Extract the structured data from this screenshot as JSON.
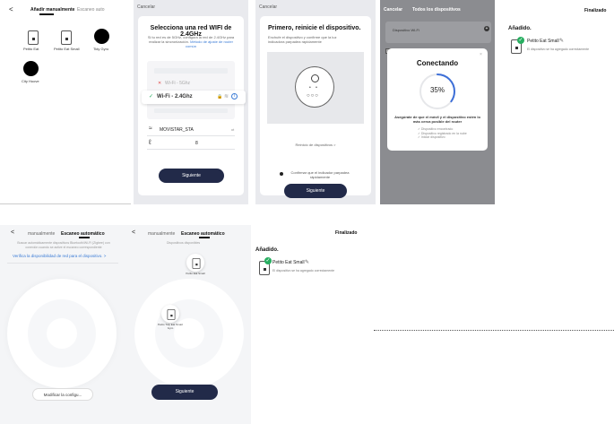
{
  "p1": {
    "back": "<",
    "tab_manual": "Añadir manualmente",
    "tab_auto": "Escaneo auto",
    "devices": [
      {
        "name": "Petito Eat",
        "icon": "feeder-icon"
      },
      {
        "name": "Petito Eat Small",
        "icon": "feeder-icon"
      },
      {
        "name": "Tidy Gyro",
        "icon": "black-circle-icon"
      },
      {
        "name": "City Hoove",
        "icon": "black-circle-icon"
      }
    ]
  },
  "p2": {
    "cancel": "Cancelar",
    "title": "Selecciona una red WIFI de 2.4GHz",
    "subtitle": "Si tu red es de 5GHz, configura la red de 2.4GHz para realizar la sincronización.",
    "link": "Método de ajuste de router común",
    "wifi_5g": "Wi-Fi - 5Ghz",
    "wifi_24g": "Wi-Fi - 2.4Ghz",
    "network": "MOVISTAR_STA",
    "password_mask": "8",
    "next": "Siguiente"
  },
  "p3": {
    "cancel": "Cancelar",
    "title": "Primero, reinicie el dispositivo.",
    "subtitle": "Enchufe el dispositivo y confirme que la luz indicadora parpadea rápidamente",
    "reset_link": "Reinicio de dispositivos >",
    "confirm": "Confirmar que el indicador parpadea rápidamente",
    "next": "Siguiente"
  },
  "p4": {
    "cancel": "Cancelar",
    "all_devices": "Todos los dispositivos",
    "wifi_label": "Dispositivo Wi-Fi",
    "modal_title": "Conectando",
    "percent": "35%",
    "progress": 0.35,
    "hint": "Asegúrate de que el móvil y el dispositivo estén lo más cerca posible del router",
    "steps": [
      "Dispositivo encontrado",
      "Dispositivo registrado en la nube",
      "Iniciar dispositivo"
    ],
    "close": "×"
  },
  "p5": {
    "done": "Finalizado",
    "added": "Añadido.",
    "device_name": "Petito Eat Small",
    "device_status": "El dispositivo se ha agregado correctamente"
  },
  "p6": {
    "back": "<",
    "tab_manual": "manualmente",
    "tab_auto": "Escaneo automático",
    "notice": "Buscar automáticamente dispositivos Bluetooth/Wi-Fi (Zigbee) con conexión cuando se active el escaneo correspondiente",
    "verify_link": "Verifica la disponibilidad de red para el dispositivo. >",
    "modify": "Modificar la configu..."
  },
  "p7": {
    "back": "<",
    "tab_manual": "manualmente",
    "tab_auto": "Escaneo automático",
    "available": "Dispositivos disponibles",
    "device_a": "Petito Eat Small",
    "device_b": "Petito Tidy Eat Smart Gyro",
    "next": "Siguiente"
  },
  "p8": {
    "done": "Finalizado",
    "added": "Añadido.",
    "device_name": "Petito Eat Small",
    "device_status": "El dispositivo se ha agregado correctamente"
  },
  "colors": {
    "primary_button": "#222a49",
    "link_blue": "#3a7bd5",
    "success_green": "#27ae60",
    "progress_blue": "#3d6fd8"
  }
}
